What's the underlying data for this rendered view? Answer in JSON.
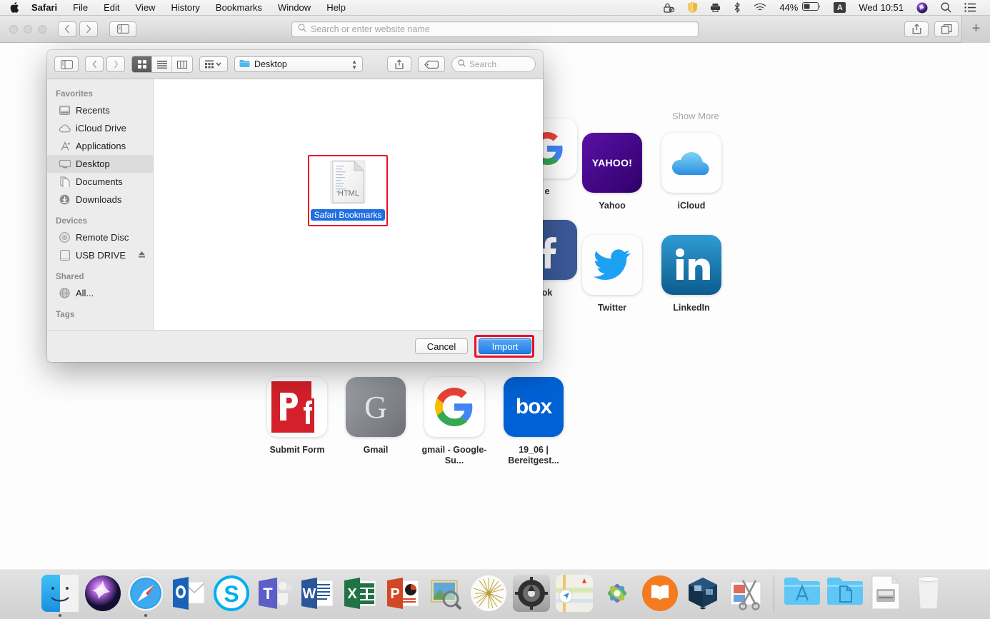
{
  "menubar": {
    "apple_icon": "apple-logo",
    "items": [
      "Safari",
      "File",
      "Edit",
      "View",
      "History",
      "Bookmarks",
      "Window",
      "Help"
    ],
    "status": {
      "lock_icon": "lock-privacy-icon",
      "shield_icon": "shield-icon",
      "printer_icon": "printer-icon",
      "bluetooth_icon": "bluetooth-icon",
      "wifi_icon": "wifi-icon",
      "battery_percent": "44%",
      "battery_icon": "battery-icon",
      "input_source": "A",
      "clock": "Wed 10:51",
      "siri_icon": "siri-icon",
      "spotlight_icon": "search-icon",
      "control_center_icon": "list-icon"
    }
  },
  "safari": {
    "toolbar": {
      "back_icon": "chevron-left-icon",
      "forward_icon": "chevron-right-icon",
      "sidebar_icon": "sidebar-icon",
      "share_icon": "share-icon",
      "tabs_icon": "tab-overview-icon",
      "new_tab_label": "+"
    },
    "address_bar": {
      "placeholder": "Search or enter website name",
      "value": "",
      "search_icon": "search-icon"
    },
    "startpage": {
      "show_more": "Show More",
      "favorites": [
        {
          "label": "Yahoo",
          "kind": "yahoo",
          "color": "#410093"
        },
        {
          "label": "iCloud",
          "kind": "icloud",
          "color": "#ffffff"
        },
        {
          "label": "Twitter",
          "kind": "twitter",
          "color": "#ffffff"
        },
        {
          "label": "LinkedIn",
          "kind": "linkedin",
          "color": "#0a66c2"
        },
        {
          "label": "Submit Form",
          "kind": "pdf",
          "color": "#d3202a"
        },
        {
          "label": "Gmail",
          "kind": "gmail-gray",
          "color": "#8a8d91"
        },
        {
          "label": "gmail - Google-Su...",
          "kind": "google",
          "color": "#ffffff"
        },
        {
          "label": "19_06 | Bereitgest...",
          "kind": "box",
          "color": "#0061d5"
        }
      ]
    }
  },
  "dialog": {
    "toolbar": {
      "sidebar_icon": "sidebar-icon",
      "back_icon": "chevron-left-icon",
      "forward_icon": "chevron-right-icon",
      "view_icon_grid": "icon-view-icon",
      "view_list": "list-view-icon",
      "view_column": "column-view-icon",
      "arrange_icon": "arrange-icon",
      "location_label": "Desktop",
      "location_icon": "folder-icon",
      "share_icon": "share-icon",
      "tag_icon": "tag-icon",
      "search_placeholder": "Search",
      "search_icon": "search-icon"
    },
    "sidebar": {
      "sections": [
        {
          "header": "Favorites",
          "items": [
            {
              "label": "Recents",
              "icon": "recents-icon",
              "selected": false
            },
            {
              "label": "iCloud Drive",
              "icon": "icloud-icon",
              "selected": false
            },
            {
              "label": "Applications",
              "icon": "applications-icon",
              "selected": false
            },
            {
              "label": "Desktop",
              "icon": "desktop-icon",
              "selected": true
            },
            {
              "label": "Documents",
              "icon": "documents-icon",
              "selected": false
            },
            {
              "label": "Downloads",
              "icon": "downloads-icon",
              "selected": false
            }
          ]
        },
        {
          "header": "Devices",
          "items": [
            {
              "label": "Remote Disc",
              "icon": "disc-icon",
              "selected": false
            },
            {
              "label": "USB DRIVE",
              "icon": "drive-icon",
              "selected": false,
              "eject": "eject-icon"
            }
          ]
        },
        {
          "header": "Shared",
          "items": [
            {
              "label": "All...",
              "icon": "network-icon",
              "selected": false
            }
          ]
        },
        {
          "header": "Tags",
          "items": []
        }
      ]
    },
    "files": [
      {
        "name": "Safari Bookmarks",
        "type": "HTML",
        "selected": true
      }
    ],
    "footer": {
      "cancel_label": "Cancel",
      "import_label": "Import"
    },
    "annotation_color": "#e8112d"
  },
  "dock": {
    "items": [
      {
        "name": "Finder",
        "running": true
      },
      {
        "name": "Siri",
        "running": false
      },
      {
        "name": "Safari",
        "running": true
      },
      {
        "name": "Outlook",
        "running": false
      },
      {
        "name": "Skype",
        "running": false
      },
      {
        "name": "Teams",
        "running": false
      },
      {
        "name": "Word",
        "running": false
      },
      {
        "name": "Excel",
        "running": false
      },
      {
        "name": "PowerPoint",
        "running": false
      },
      {
        "name": "Preview",
        "running": false
      },
      {
        "name": "Dandelion",
        "running": false
      },
      {
        "name": "System Preferences",
        "running": false
      },
      {
        "name": "Maps",
        "running": false
      },
      {
        "name": "Photos",
        "running": false
      },
      {
        "name": "iBooks",
        "running": false
      },
      {
        "name": "VirtualBox",
        "running": false
      },
      {
        "name": "Grab",
        "running": false
      },
      {
        "name": "Applications",
        "running": false
      },
      {
        "name": "Documents",
        "running": false
      },
      {
        "name": "Downloads",
        "running": false
      },
      {
        "name": "Trash",
        "running": false
      }
    ]
  }
}
